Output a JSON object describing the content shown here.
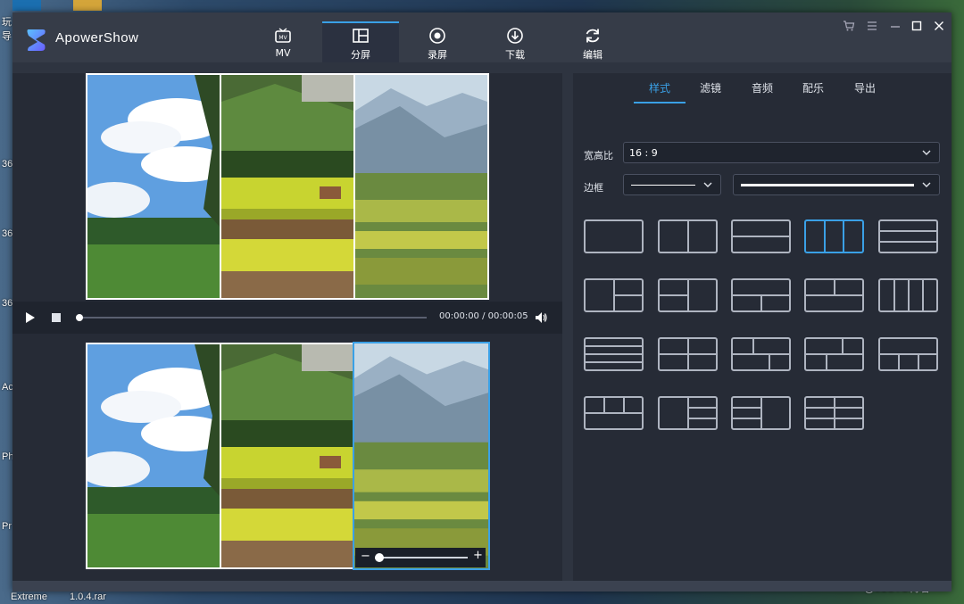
{
  "app": {
    "name": "ApowerShow"
  },
  "nav": [
    {
      "label": "MV",
      "icon": "tv-icon"
    },
    {
      "label": "分屏",
      "icon": "split-screen-icon",
      "active": true
    },
    {
      "label": "录屏",
      "icon": "record-icon"
    },
    {
      "label": "下载",
      "icon": "download-icon"
    },
    {
      "label": "编辑",
      "icon": "refresh-icon"
    }
  ],
  "player": {
    "time": "00:00:00 / 00:00:05",
    "progress": 0.0
  },
  "right_tabs": [
    "样式",
    "滤镜",
    "音频",
    "配乐",
    "导出"
  ],
  "aspect": {
    "label": "宽高比",
    "value": "16 : 9"
  },
  "border": {
    "label": "边框"
  },
  "layouts": {
    "selected_index": 3,
    "count": 19
  },
  "zoom": {
    "minus": "−",
    "plus": "+",
    "value": 0.1
  },
  "desktop": {
    "left_labels": [
      "玩",
      "导",
      "36",
      "36",
      "36",
      "Ac",
      "Ph",
      "Pr"
    ],
    "bottom_labels": [
      "Extreme",
      "1.0.4.rar"
    ],
    "watermark": "@51CTO博客"
  },
  "colors": {
    "accent": "#3aa0e6",
    "window": "#2e3440",
    "titlebar": "#363c48"
  }
}
